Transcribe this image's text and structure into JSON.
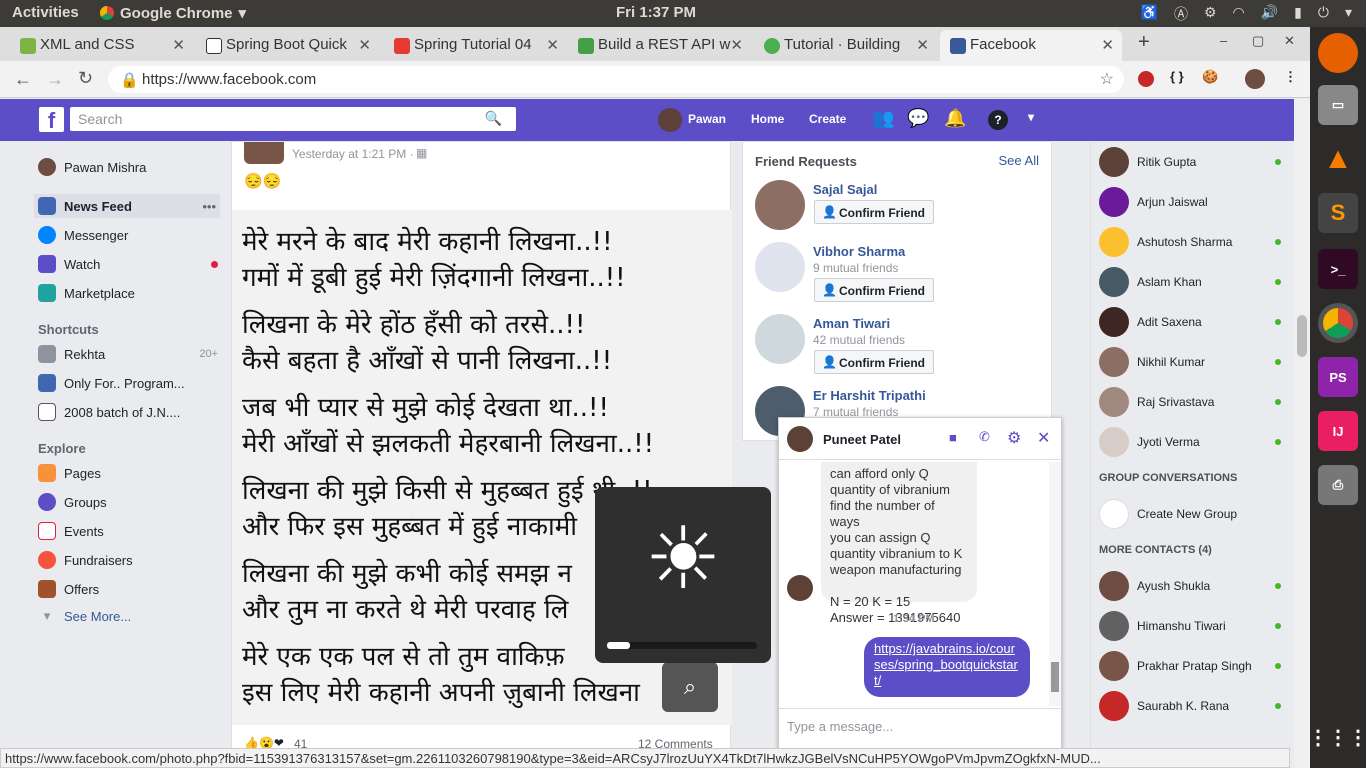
{
  "system": {
    "activities": "Activities",
    "app": "Google Chrome",
    "clock": "Fri  1:37 PM"
  },
  "tabs": [
    {
      "label": "XML and CSS",
      "color": "#7cb342"
    },
    {
      "label": "Spring Boot Quick",
      "color": "#333"
    },
    {
      "label": "Spring Tutorial 04",
      "color": "#e53935"
    },
    {
      "label": "Build a REST API w",
      "color": "#43a047"
    },
    {
      "label": "Tutorial · Building",
      "color": "#4caf50"
    },
    {
      "label": "Facebook",
      "color": "#3b5998"
    }
  ],
  "address": {
    "url": "https://www.facebook.com"
  },
  "fb": {
    "search_placeholder": "Search",
    "user": "Pawan",
    "home": "Home",
    "create": "Create"
  },
  "left": {
    "profile": "Pawan Mishra",
    "news_feed": "News Feed",
    "messenger": "Messenger",
    "watch": "Watch",
    "marketplace": "Marketplace",
    "shortcuts": "Shortcuts",
    "rekhta": "Rekhta",
    "rekhta_count": "20+",
    "only_for": "Only For.. Program...",
    "batch": "2008 batch of J.N....",
    "explore": "Explore",
    "pages": "Pages",
    "groups": "Groups",
    "events": "Events",
    "fundraisers": "Fundraisers",
    "offers": "Offers",
    "see_more": "See More..."
  },
  "post": {
    "time": "Yesterday at 1:21 PM ·",
    "emoji": "😔😔",
    "reactions": "41",
    "comments": "12 Comments",
    "lines": [
      "मेरे मरने के बाद मेरी कहानी लिखना..!!",
      "गमों में डूबी हुई मेरी ज़िंदगानी लिखना..!!",
      "लिखना के मेरे होंठ हँसी को तरसे..!!",
      "कैसे बहता है आँखों से पानी लिखना..!!",
      "जब भी प्यार से मुझे कोई देखता था..!!",
      "मेरी आँखों से झलकती मेहरबानी लिखना..!!",
      "लिखना की मुझे किसी से मुहब्बत हुई थी..!!",
      "और फिर इस मुहब्बत में हुई नाकामी",
      "लिखना की मुझे कभी कोई समझ न",
      "और तुम ना करते थे मेरी परवाह लि",
      "मेरे एक एक पल से तो तुम वाकिफ़",
      "इस लिए मेरी कहानी अपनी ज़ुबानी लिखना"
    ]
  },
  "friend_requests": {
    "title": "Friend Requests",
    "see_all": "See All",
    "confirm": "Confirm Friend",
    "people": [
      {
        "name": "Sajal Sajal",
        "mutual": ""
      },
      {
        "name": "Vibhor Sharma",
        "mutual": "9 mutual friends"
      },
      {
        "name": "Aman Tiwari",
        "mutual": "42 mutual friends"
      },
      {
        "name": "Er Harshit Tripathi",
        "mutual": "7 mutual friends"
      }
    ]
  },
  "chat": {
    "name": "Puneet Patel",
    "msg_lines": [
      "can afford only Q",
      "quantity of vibranium",
      "find the number of ways",
      "you can assign Q",
      "quantity vibranium to K",
      "weapon manufacturing",
      "",
      "N = 20 K = 15",
      "Answer = 1391975640"
    ],
    "time": "1:34 PM",
    "link": "https://javabrains.io/courses/spring_bootquickstart/",
    "placeholder": "Type a message..."
  },
  "contacts": [
    {
      "name": "Ritik Gupta",
      "online": true
    },
    {
      "name": "Arjun Jaiswal",
      "online": false
    },
    {
      "name": "Ashutosh Sharma",
      "online": true
    },
    {
      "name": "Aslam Khan",
      "online": true
    },
    {
      "name": "Adit Saxena",
      "online": true
    },
    {
      "name": "Nikhil Kumar",
      "online": true
    },
    {
      "name": "Raj Srivastava",
      "online": true
    },
    {
      "name": "Jyoti Verma",
      "online": true
    }
  ],
  "group_conv": {
    "title": "GROUP CONVERSATIONS",
    "create": "Create New Group"
  },
  "more_contacts": {
    "title": "MORE CONTACTS (4)",
    "people": [
      {
        "name": "Ayush Shukla"
      },
      {
        "name": "Himanshu Tiwari"
      },
      {
        "name": "Prakhar Pratap Singh"
      },
      {
        "name": "Saurabh K. Rana"
      }
    ]
  },
  "brightness": {
    "level": 0.15
  },
  "status_url": "https://www.facebook.com/photo.php?fbid=115391376313157&set=gm.2261103260798190&type=3&eid=ARCsyJ7lrozUuYX4TkDt7lHwkzJGBelVsNCuHP5YOWgoPVmJpvmZOgkfxN-MUD..."
}
